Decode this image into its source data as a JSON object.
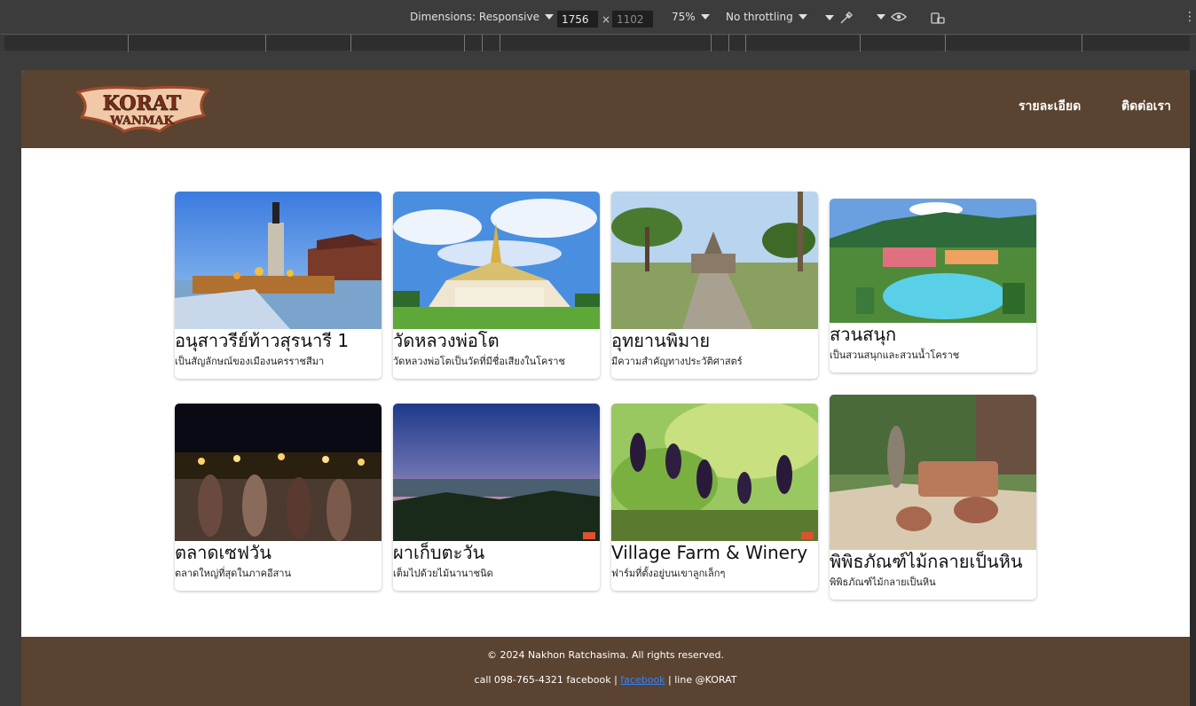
{
  "devtools": {
    "dimensions_label": "Dimensions: Responsive",
    "width_value": "1756",
    "height_placeholder": "1102",
    "times": "×",
    "zoom": "75%",
    "throttling": "No throttling",
    "more": "⋮"
  },
  "header": {
    "logo_text_top": "KORAT",
    "logo_text_bottom": "WANMAK",
    "nav": [
      "รายละเอียด",
      "ติดต่อเรา"
    ]
  },
  "cards": [
    {
      "title": "อนุสาวรีย์ท้าวสุรนารี 1",
      "desc": "เป็นสัญลักษณ์ของเมืองนครราชสีมา"
    },
    {
      "title": "วัดหลวงพ่อโต",
      "desc": "วัดหลวงพ่อโตเป็นวัดที่มีชื่อเสียงในโคราช"
    },
    {
      "title": "อุทยานพิมาย",
      "desc": "มีความสำคัญทางประวัติศาสตร์"
    },
    {
      "title": "สวนสนุก",
      "desc": "เป็นสวนสนุกและสวนน้ำโคราช"
    },
    {
      "title": "ตลาดเซฟวัน",
      "desc": "ตลาดใหญ่ที่สุดในภาคอีสาน"
    },
    {
      "title": "ผาเก็บตะวัน",
      "desc": "เต็มไปด้วยไม้นานาชนิด"
    },
    {
      "title": "Village Farm & Winery",
      "desc": "ฟาร์มที่ตั้งอยู่บนเขาลูกเล็กๆ"
    },
    {
      "title": "พิพิธภัณฑ์ไม้กลายเป็นหิน",
      "desc": "พิพิธภัณฑ์ไม้กลายเป็นหิน"
    }
  ],
  "footer": {
    "copyright": "© 2024 Nakhon Ratchasima. All rights reserved.",
    "contact_prefix": "call 098-765-4321 facebook |",
    "facebook_link": "facebook",
    "contact_suffix": "| line @KORAT"
  }
}
